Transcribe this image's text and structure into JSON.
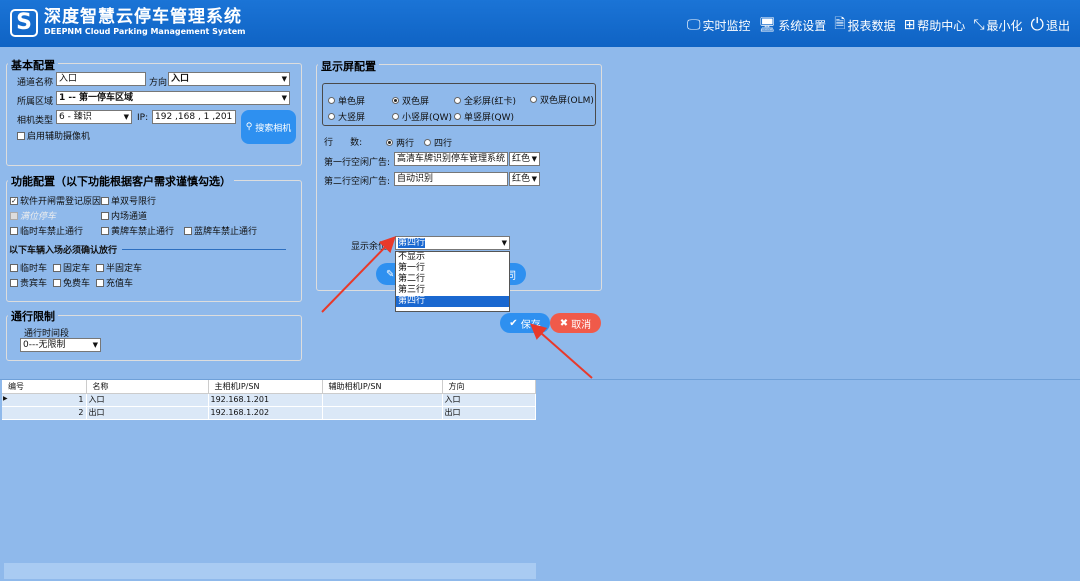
{
  "header": {
    "logo_glyph": "S",
    "title_cn": "深度智慧云停车管理系统",
    "title_en": "DEEPNM Cloud Parking Management System",
    "nav": [
      {
        "label": "实时监控",
        "icon": "monitor-icon",
        "glyph": "🖵"
      },
      {
        "label": "系统设置",
        "icon": "settings-screen-icon",
        "glyph": "🖥"
      },
      {
        "label": "报表数据",
        "icon": "report-icon",
        "glyph": "🗎"
      },
      {
        "label": "帮助中心",
        "icon": "grid-icon",
        "glyph": "⊞"
      },
      {
        "label": "最小化",
        "icon": "minimize-icon",
        "glyph": "⤡"
      },
      {
        "label": "退出",
        "icon": "power-icon",
        "glyph": "⏻"
      }
    ]
  },
  "basic": {
    "title": "基本配置",
    "channel_name_label": "通道名称",
    "channel_name": "入口",
    "direction_label": "方向",
    "direction": "入口",
    "area_label": "所属区域",
    "area": "1 -- 第一停车区域",
    "camera_type_label": "相机类型",
    "camera_type": "6 -  臻识",
    "ip_label": "IP:",
    "ip": "192 ,168 ,  1   ,201",
    "search_camera": "搜索相机",
    "aux_camera": "启用辅助摄像机"
  },
  "func": {
    "title": "功能配置（以下功能根据客户需求谨慎勾选）",
    "items": [
      {
        "label": "软件开闸需登记原因",
        "checked": true
      },
      {
        "label": "单双号限行",
        "checked": false
      },
      {
        "label": "满位停车",
        "checked": false
      },
      {
        "label": "内场通道",
        "checked": false
      },
      {
        "label": "临时车禁止通行",
        "checked": false
      },
      {
        "label": "黄牌车禁止通行",
        "checked": false
      },
      {
        "label": "蓝牌车禁止通行",
        "checked": false
      }
    ],
    "confirm_title": "以下车辆入场必须确认放行",
    "confirm_items": [
      {
        "label": "临时车"
      },
      {
        "label": "固定车"
      },
      {
        "label": "半固定车"
      },
      {
        "label": "贵宾车"
      },
      {
        "label": "免费车"
      },
      {
        "label": "充值车"
      }
    ]
  },
  "limit": {
    "title": "通行限制",
    "period_label": "通行时间段",
    "period": "0---无限制"
  },
  "display": {
    "title": "显示屏配置",
    "screen_types": [
      {
        "label": "单色屏",
        "on": false
      },
      {
        "label": "双色屏",
        "on": true
      },
      {
        "label": "全彩屏(红卡)",
        "on": false
      },
      {
        "label": "双色屏(OLM)",
        "on": false
      },
      {
        "label": "大竖屏",
        "on": false
      },
      {
        "label": "小竖屏(QW)",
        "on": false
      },
      {
        "label": "单竖屏(QW)",
        "on": false
      }
    ],
    "rows_label": "行      数:",
    "rows": [
      {
        "label": "两行",
        "on": true
      },
      {
        "label": "四行",
        "on": false
      }
    ],
    "line1_label": "第一行空闲广告:",
    "line1": "高清车牌识别停车管理系统",
    "line1_color": "红色",
    "line2_label": "第二行空闲广告:",
    "line2": "自动识别",
    "line2_color": "红色",
    "remain_label": "显示余位:",
    "remain": "第四行",
    "remain_options": [
      "不显示",
      "第一行",
      "第二行",
      "第三行",
      "第四行"
    ],
    "hidden_btn_tail": "同"
  },
  "actions": {
    "save": "保存",
    "cancel": "取消"
  },
  "table": {
    "columns": [
      "编号",
      "名称",
      "主相机IP/SN",
      "辅助相机IP/SN",
      "方向"
    ],
    "rows": [
      {
        "id": "1",
        "name": "入口",
        "main_ip": "192.168.1.201",
        "aux": "",
        "dir": "入口"
      },
      {
        "id": "2",
        "name": "出口",
        "main_ip": "192.168.1.202",
        "aux": "",
        "dir": "出口"
      }
    ]
  }
}
